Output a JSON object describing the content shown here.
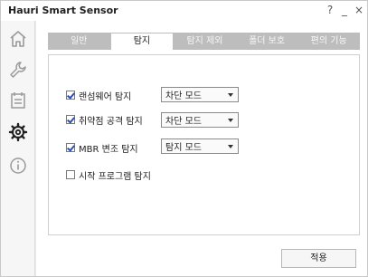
{
  "window": {
    "title": "Hauri Smart Sensor",
    "help": "?",
    "minimize": "_",
    "close": "×"
  },
  "sidebar": {
    "items": [
      {
        "icon": "home-icon"
      },
      {
        "icon": "wrench-icon"
      },
      {
        "icon": "list-icon"
      },
      {
        "icon": "gear-icon",
        "active": true
      },
      {
        "icon": "info-icon"
      }
    ]
  },
  "tabs": [
    {
      "label": "일반"
    },
    {
      "label": "탐지",
      "active": true
    },
    {
      "label": "탐지 제외"
    },
    {
      "label": "폴더 보호"
    },
    {
      "label": "편의 기능"
    }
  ],
  "settings": [
    {
      "label": "랜섬웨어 탐지",
      "checked": true,
      "mode": "차단 모드"
    },
    {
      "label": "취약점 공격 탐지",
      "checked": true,
      "mode": "차단 모드"
    },
    {
      "label": "MBR 변조 탐지",
      "checked": true,
      "mode": "탐지 모드"
    },
    {
      "label": "시작 프로그램 탐지",
      "checked": false
    }
  ],
  "apply_label": "적용",
  "colors": {
    "accent_check": "#2d4fb0",
    "tab_inactive_bg": "#bdbdbd",
    "window_bg": "#ebebeb"
  }
}
